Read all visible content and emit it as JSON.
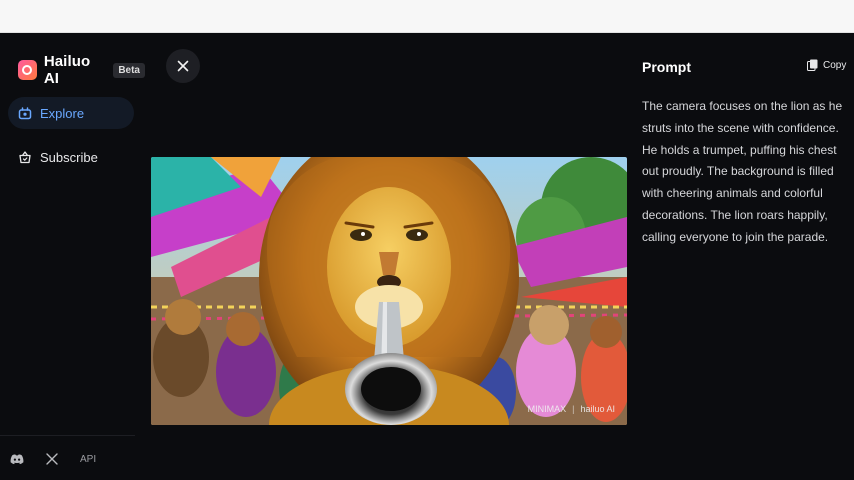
{
  "app": {
    "name": "Hailuo AI",
    "badge": "Beta"
  },
  "sidebar": {
    "items": [
      {
        "label": "Explore",
        "icon": "explore-icon",
        "active": true
      },
      {
        "label": "Subscribe",
        "icon": "subscribe-icon",
        "active": false
      }
    ],
    "footer": {
      "discord_icon": "discord-icon",
      "x_icon": "x-icon",
      "api_label": "API"
    }
  },
  "viewer": {
    "close_icon": "close-icon",
    "watermark": {
      "brand1": "MINIMAX",
      "separator": "|",
      "brand2": "hailuo AI"
    }
  },
  "prompt_panel": {
    "title": "Prompt",
    "copy_label": "Copy",
    "text": "The camera focuses on the lion as he struts into the scene with confidence. He holds a trumpet, puffing his chest out proudly. The background is filled with cheering animals and colorful decorations. The lion roars happily, calling everyone to join the parade."
  },
  "colors": {
    "accent": "#6aa8ff",
    "background": "#0b0c0f",
    "brand_gradient_start": "#ff5aa0",
    "brand_gradient_end": "#ff7a3c"
  }
}
